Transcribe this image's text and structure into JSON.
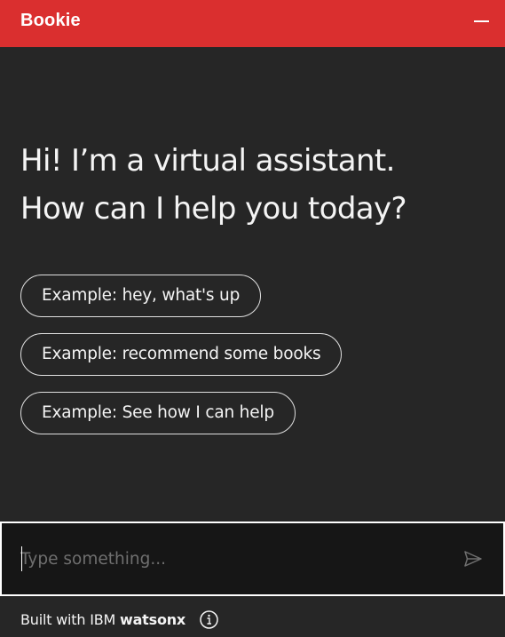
{
  "header": {
    "title": "Bookie",
    "minimize_icon": "minimize-icon",
    "background_color": "#da2f2f"
  },
  "greeting": {
    "line1": "Hi! I’m a virtual assistant.",
    "line2": "How can I help you today?"
  },
  "suggestions": [
    "Example: hey, what's up",
    "Example: recommend some books",
    "Example: See how I can help"
  ],
  "input": {
    "placeholder": "Type something...",
    "value": "",
    "send_icon": "send-icon"
  },
  "footer": {
    "prefix": "Built with IBM",
    "brand": "watsonx",
    "info_icon": "info-icon"
  },
  "colors": {
    "background": "#262626",
    "input_background": "#161616",
    "text": "#f4f4f4",
    "placeholder": "#6f6f6f"
  }
}
